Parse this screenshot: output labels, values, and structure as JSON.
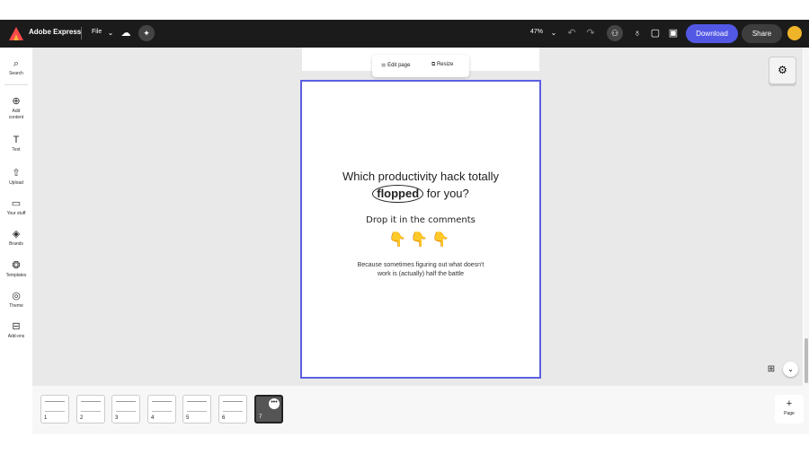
{
  "app": {
    "name": "Adobe Express",
    "file_label": "File",
    "brand_color": "#5258e4"
  },
  "topbar": {
    "zoom": "47%",
    "download_label": "Download",
    "share_label": "Share",
    "icons": [
      "chevron-down-icon",
      "cloud-icon",
      "magic-icon",
      "undo-icon",
      "redo-icon",
      "user-add-icon",
      "lightbulb-icon",
      "comment-icon",
      "present-icon"
    ]
  },
  "sidebar": {
    "items": [
      {
        "icon": "search-icon",
        "glyph": "⌕",
        "label": "Search"
      },
      {
        "icon": "add-icon",
        "glyph": "⊕",
        "label": "Add content"
      },
      {
        "icon": "text-icon",
        "glyph": "T",
        "label": "Text"
      },
      {
        "icon": "upload-icon",
        "glyph": "⇧",
        "label": "Upload"
      },
      {
        "icon": "folder-icon",
        "glyph": "▭",
        "label": "Your stuff"
      },
      {
        "icon": "brands-icon",
        "glyph": "◈",
        "label": "Brands"
      },
      {
        "icon": "templates-icon",
        "glyph": "❂",
        "label": "Templates"
      },
      {
        "icon": "theme-icon",
        "glyph": "◎",
        "label": "Theme"
      },
      {
        "icon": "addons-icon",
        "glyph": "⊟",
        "label": "Add-ons"
      }
    ]
  },
  "page_toolbar": {
    "edit_label": "Edit page",
    "resize_label": "Resize"
  },
  "page": {
    "question_line1": "Which productivity hack totally",
    "question_highlight": "flopped",
    "question_line2_rest": " for you?",
    "cta": "Drop it in the comments",
    "emoji": "👇👇👇",
    "subtext": "Because sometimes figuring out what doesn't work is (actually) half the battle"
  },
  "filmstrip": {
    "pages": [
      "1",
      "2",
      "3",
      "4",
      "5",
      "6",
      "7"
    ],
    "active_page": "7",
    "add_page_label": "Page"
  }
}
